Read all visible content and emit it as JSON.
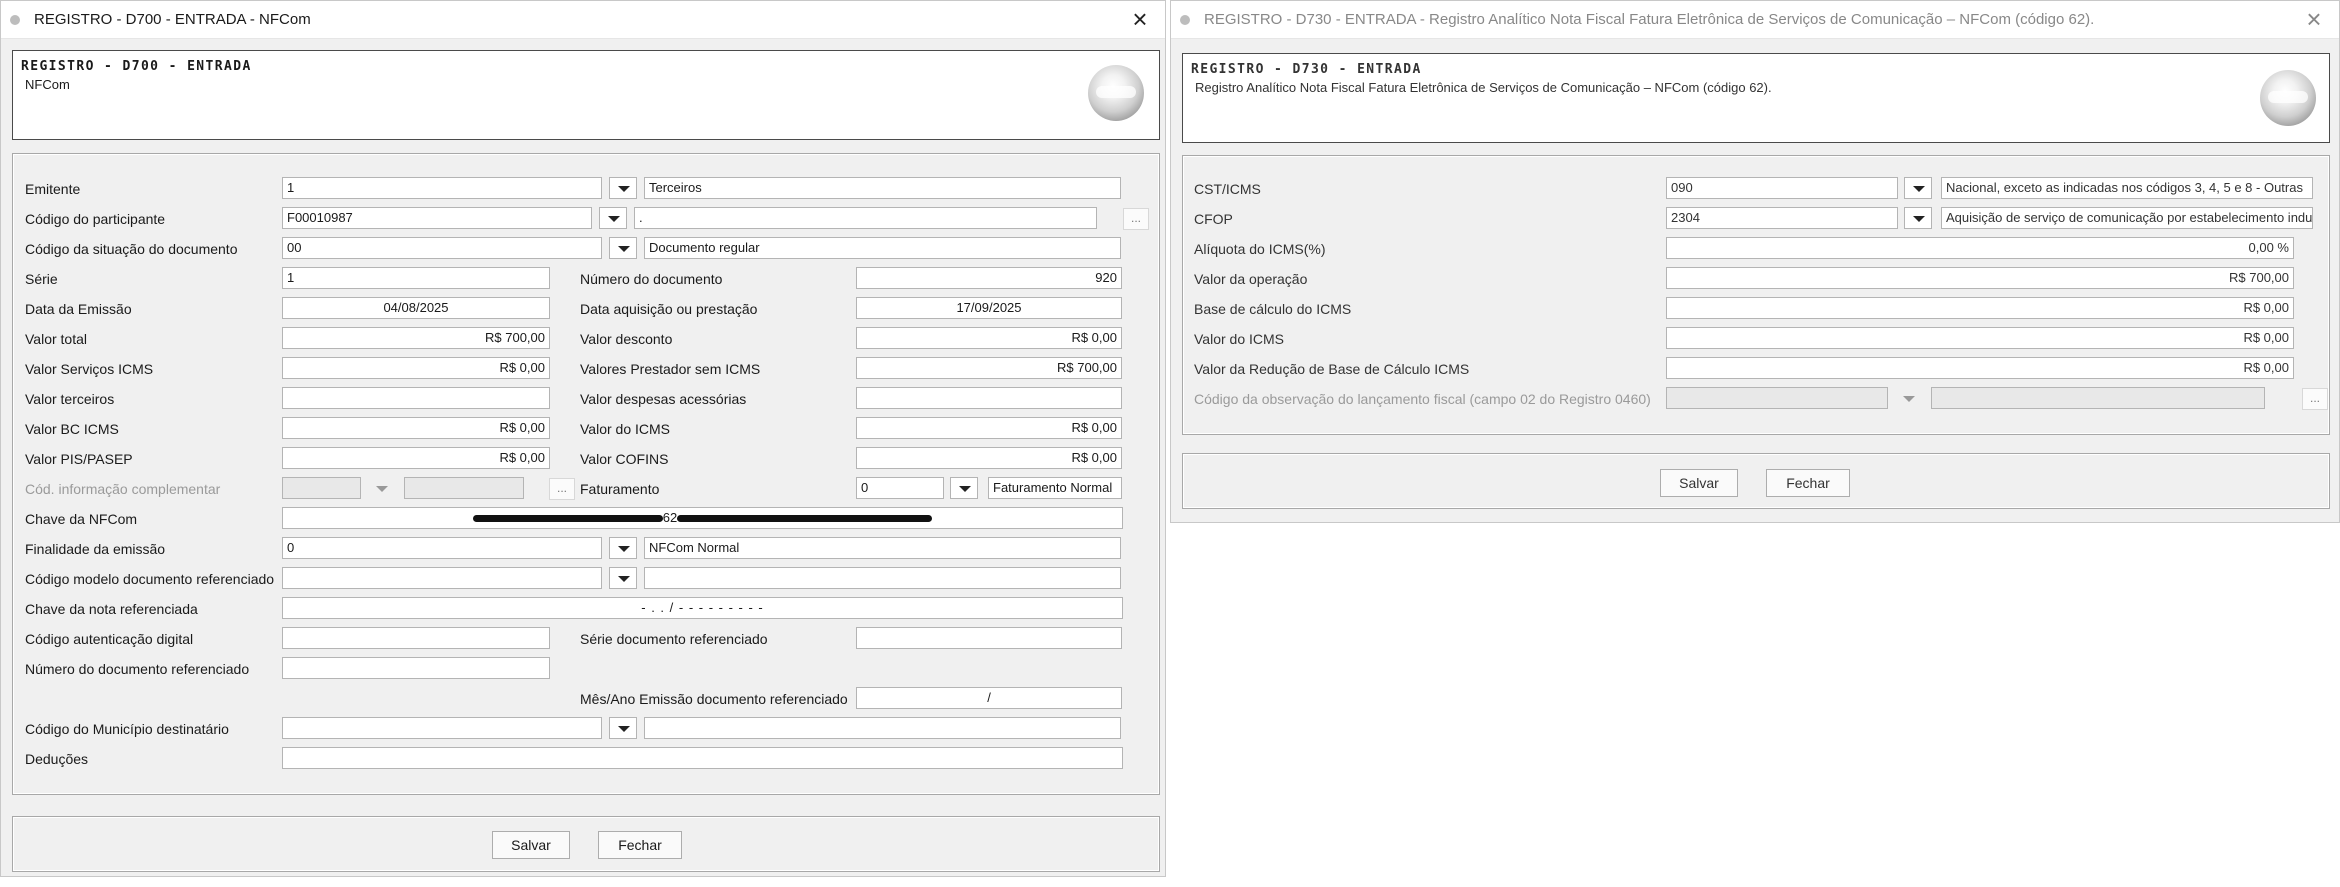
{
  "w1": {
    "title": "REGISTRO - D700 - ENTRADA - NFCom",
    "header_title": "REGISTRO - D700 - ENTRADA",
    "header_sub": "NFCom",
    "labels": {
      "emitente": "Emitente",
      "participante": "Código do participante",
      "situacao": "Código da situação do documento",
      "serie": "Série",
      "numero": "Número do documento",
      "data_emissao": "Data da Emissão",
      "data_aquisicao": "Data aquisição ou prestação",
      "valor_total": "Valor total",
      "valor_desconto": "Valor desconto",
      "valor_servicos": "Valor Serviços ICMS",
      "valores_prestador": "Valores Prestador sem ICMS",
      "valor_terceiros": "Valor terceiros",
      "valor_despesas": "Valor despesas acessórias",
      "valor_bc": "Valor BC ICMS",
      "valor_icms": "Valor do ICMS",
      "valor_pis": "Valor PIS/PASEP",
      "valor_cofins": "Valor COFINS",
      "cod_info": "Cód. informação complementar",
      "faturamento": "Faturamento",
      "chave": "Chave da NFCom",
      "finalidade": "Finalidade da emissão",
      "modelo_ref": "Código modelo documento referenciado",
      "chave_ref": "Chave da nota referenciada",
      "autenticacao": "Código autenticação digital",
      "serie_ref": "Série documento referenciado",
      "numero_ref": "Número do documento referenciado",
      "mes_ano": "Mês/Ano Emissão documento referenciado",
      "municipio": "Código do Município destinatário",
      "deducoes": "Deduções"
    },
    "values": {
      "emitente": "1",
      "emitente_desc": "Terceiros",
      "participante": "F00010987",
      "participante_desc": ".",
      "situacao": "00",
      "situacao_desc": "Documento regular",
      "serie": "1",
      "numero": "920",
      "data_emissao": "04/08/2025",
      "data_aquisicao": "17/09/2025",
      "valor_total": "R$ 700,00",
      "valor_desconto": "R$ 0,00",
      "valor_servicos": "R$ 0,00",
      "valores_prestador": "R$ 700,00",
      "valor_bc": "R$ 0,00",
      "valor_icms": "R$ 0,00",
      "valor_pis": "R$ 0,00",
      "valor_cofins": "R$ 0,00",
      "faturamento": "0",
      "faturamento_desc": "Faturamento Normal",
      "chave_mid": "62",
      "finalidade": "0",
      "finalidade_desc": "NFCom Normal",
      "chave_ref_mask": "-  .  .  /   -  -  -  -  -  -  -  -  -",
      "mes_ano_mask": "/"
    },
    "buttons": {
      "salvar": "Salvar",
      "fechar": "Fechar",
      "ellipsis": "..."
    }
  },
  "w2": {
    "title": "REGISTRO - D730 - ENTRADA - Registro Analítico Nota Fiscal Fatura Eletrônica de Serviços de Comunicação – NFCom (código 62).",
    "header_title": "REGISTRO - D730 - ENTRADA",
    "header_sub": "Registro Analítico Nota Fiscal Fatura Eletrônica de Serviços de Comunicação – NFCom (código 62).",
    "labels": {
      "cst": "CST/ICMS",
      "cfop": "CFOP",
      "aliquota": "Alíquota do ICMS(%)",
      "valor_operacao": "Valor da operação",
      "base_calculo": "Base de cálculo do ICMS",
      "valor_icms": "Valor do ICMS",
      "valor_reducao": "Valor da Redução de Base de Cálculo ICMS",
      "cod_obs": "Código da observação do lançamento fiscal (campo 02 do Registro 0460)"
    },
    "values": {
      "cst": "090",
      "cst_desc": "Nacional, exceto as indicadas nos códigos 3, 4, 5 e 8 - Outras",
      "cfop": "2304",
      "cfop_desc": "Aquisição de serviço de comunicação por estabelecimento industrial",
      "aliquota": "0,00 %",
      "valor_operacao": "R$ 700,00",
      "base_calculo": "R$ 0,00",
      "valor_icms": "R$ 0,00",
      "valor_reducao": "R$ 0,00"
    },
    "buttons": {
      "salvar": "Salvar",
      "fechar": "Fechar",
      "ellipsis": "..."
    }
  }
}
